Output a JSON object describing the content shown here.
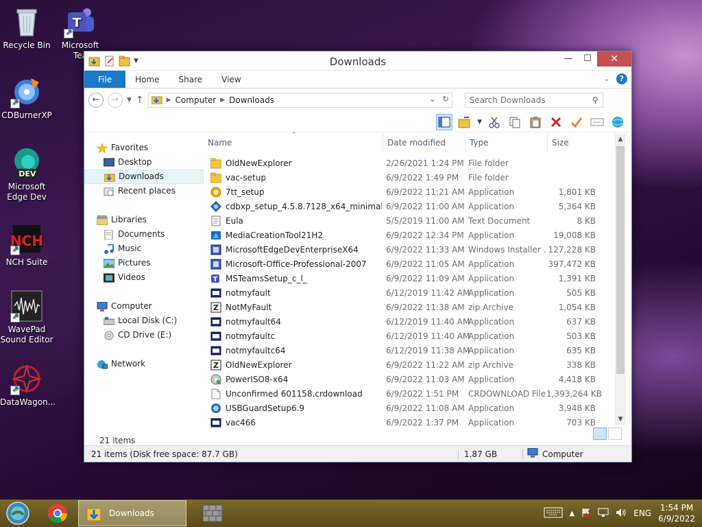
{
  "desktop": {
    "icons": [
      {
        "label": "Recycle Bin"
      },
      {
        "label": "Microsoft Tea"
      },
      {
        "label": "CDBurnerXP"
      },
      {
        "label": "Microsoft Edge Dev"
      },
      {
        "label": "NCH Suite"
      },
      {
        "label": "WavePad Sound Editor"
      },
      {
        "label": "DataWagon..."
      }
    ],
    "edge_badge": "DEV"
  },
  "window": {
    "title": "Downloads",
    "controls": {
      "minimize": "—",
      "maximize": "☐",
      "close": "✕"
    }
  },
  "ribbon": {
    "tabs": [
      "File",
      "Home",
      "Share",
      "View"
    ],
    "help": "?"
  },
  "address": {
    "crumbs": [
      "Computer",
      "Downloads"
    ],
    "search_placeholder": "Search Downloads"
  },
  "nav": {
    "favorites": "Favorites",
    "favorites_items": [
      "Desktop",
      "Downloads",
      "Recent places"
    ],
    "libraries": "Libraries",
    "libraries_items": [
      "Documents",
      "Music",
      "Pictures",
      "Videos"
    ],
    "computer": "Computer",
    "computer_items": [
      "Local Disk (C:)",
      "CD Drive (E:)"
    ],
    "network": "Network"
  },
  "columns": {
    "name": "Name",
    "date": "Date modified",
    "type": "Type",
    "size": "Size"
  },
  "files": [
    {
      "name": "OldNewExplorer",
      "date": "2/26/2021 1:24 PM",
      "type": "File folder",
      "size": "",
      "icon": "folder"
    },
    {
      "name": "vac-setup",
      "date": "6/9/2022 1:49 PM",
      "type": "File folder",
      "size": "",
      "icon": "folder"
    },
    {
      "name": "7tt_setup",
      "date": "6/9/2022 11:21 AM",
      "type": "Application",
      "size": "1,801 KB",
      "icon": "app-orange"
    },
    {
      "name": "cdbxp_setup_4.5.8.7128_x64_minimal",
      "date": "6/9/2022 11:00 AM",
      "type": "Application",
      "size": "5,364 KB",
      "icon": "app-shield"
    },
    {
      "name": "Eula",
      "date": "5/5/2019 11:00 AM",
      "type": "Text Document",
      "size": "8 KB",
      "icon": "text"
    },
    {
      "name": "MediaCreationTool21H2",
      "date": "6/9/2022 12:34 PM",
      "type": "Application",
      "size": "19,008 KB",
      "icon": "app-media"
    },
    {
      "name": "MicrosoftEdgeDevEnterpriseX64",
      "date": "6/9/2022 11:33 AM",
      "type": "Windows Installer ...",
      "size": "127,228 KB",
      "icon": "msi"
    },
    {
      "name": "Microsoft-Office-Professional-2007",
      "date": "6/9/2022 11:05 AM",
      "type": "Application",
      "size": "397,472 KB",
      "icon": "msi"
    },
    {
      "name": "MSTeamsSetup_c_l_",
      "date": "6/9/2022 11:09 AM",
      "type": "Application",
      "size": "1,391 KB",
      "icon": "app-teams"
    },
    {
      "name": "notmyfault",
      "date": "6/12/2019 11:42 AM",
      "type": "Application",
      "size": "505 KB",
      "icon": "app-dark"
    },
    {
      "name": "NotMyFault",
      "date": "6/9/2022 11:38 AM",
      "type": "zip Archive",
      "size": "1,054 KB",
      "icon": "zip"
    },
    {
      "name": "notmyfault64",
      "date": "6/12/2019 11:40 AM",
      "type": "Application",
      "size": "637 KB",
      "icon": "app-dark"
    },
    {
      "name": "notmyfaultc",
      "date": "6/12/2019 11:40 AM",
      "type": "Application",
      "size": "503 KB",
      "icon": "app-dark"
    },
    {
      "name": "notmyfaultc64",
      "date": "6/12/2019 11:38 AM",
      "type": "Application",
      "size": "635 KB",
      "icon": "app-dark"
    },
    {
      "name": "OldNewExplorer",
      "date": "6/9/2022 11:22 AM",
      "type": "zip Archive",
      "size": "338 KB",
      "icon": "zip"
    },
    {
      "name": "PowerISO8-x64",
      "date": "6/9/2022 11:03 AM",
      "type": "Application",
      "size": "4,418 KB",
      "icon": "app-iso"
    },
    {
      "name": "Unconfirmed 601158.crdownload",
      "date": "6/9/2022 1:51 PM",
      "type": "CRDOWNLOAD File",
      "size": "1,393,264 KB",
      "icon": "blank"
    },
    {
      "name": "USBGuardSetup6.9",
      "date": "6/9/2022 11:08 AM",
      "type": "Application",
      "size": "3,948 KB",
      "icon": "app-usb"
    },
    {
      "name": "vac466",
      "date": "6/9/2022 1:37 PM",
      "type": "Application",
      "size": "703 KB",
      "icon": "app-dark"
    }
  ],
  "status": {
    "item_count": "21 items",
    "detail": "21 items (Disk free space: 87.7 GB)",
    "size": "1.87 GB",
    "location": "Computer"
  },
  "taskbar": {
    "active_app": "Downloads",
    "lang": "ENG",
    "time": "1:54 PM",
    "date": "6/9/2022"
  }
}
